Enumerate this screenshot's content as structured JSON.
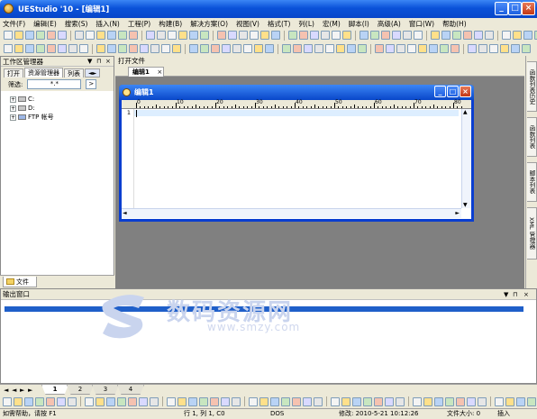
{
  "window": {
    "title": "UEStudio '10 - [编辑1]"
  },
  "menu": [
    "文件(F)",
    "编辑(E)",
    "搜索(S)",
    "插入(N)",
    "工程(P)",
    "构建(B)",
    "解决方案(O)",
    "视图(V)",
    "格式(T)",
    "列(L)",
    "宏(M)",
    "脚本(I)",
    "高级(A)",
    "窗口(W)",
    "帮助(H)"
  ],
  "left_panel": {
    "title": "工作区管理器",
    "tabs": [
      "打开",
      "资源管理器",
      "列表"
    ],
    "filter_label": "筛选:",
    "filter_value": "*.*",
    "filter_button": ">",
    "tree": [
      "C:",
      "D:",
      "FTP 帐号"
    ],
    "bottom_tab": "文件"
  },
  "editor": {
    "open_files_label": "打开文件",
    "doc_tab": "编辑1",
    "doc_tab_close": "×",
    "child_title": "编辑1",
    "ruler_marks": [
      "0",
      "10",
      "20",
      "30",
      "40",
      "50",
      "60",
      "70",
      "80"
    ],
    "line_numbers": [
      "1"
    ]
  },
  "right_tabs": [
    "函数列表历史",
    "函数列表",
    "脚本列表",
    "XML 管理器"
  ],
  "output": {
    "title": "输出窗口"
  },
  "watermark": {
    "text": "数码资源网",
    "url": "www.smzy.com"
  },
  "sheet_tabs": [
    "1",
    "2",
    "3",
    "4"
  ],
  "status": {
    "help": "如需帮助，请按 F1",
    "position": "行 1, 列 1, C0",
    "format": "DOS",
    "modified": "修改:    2010-5-21  10:12:26",
    "filesize": "文件大小: 0",
    "mode": "插入"
  },
  "colors": {
    "titlebar": "#0a52d9",
    "output_bar": "#1f5fc9",
    "editor_bg": "#808080"
  }
}
